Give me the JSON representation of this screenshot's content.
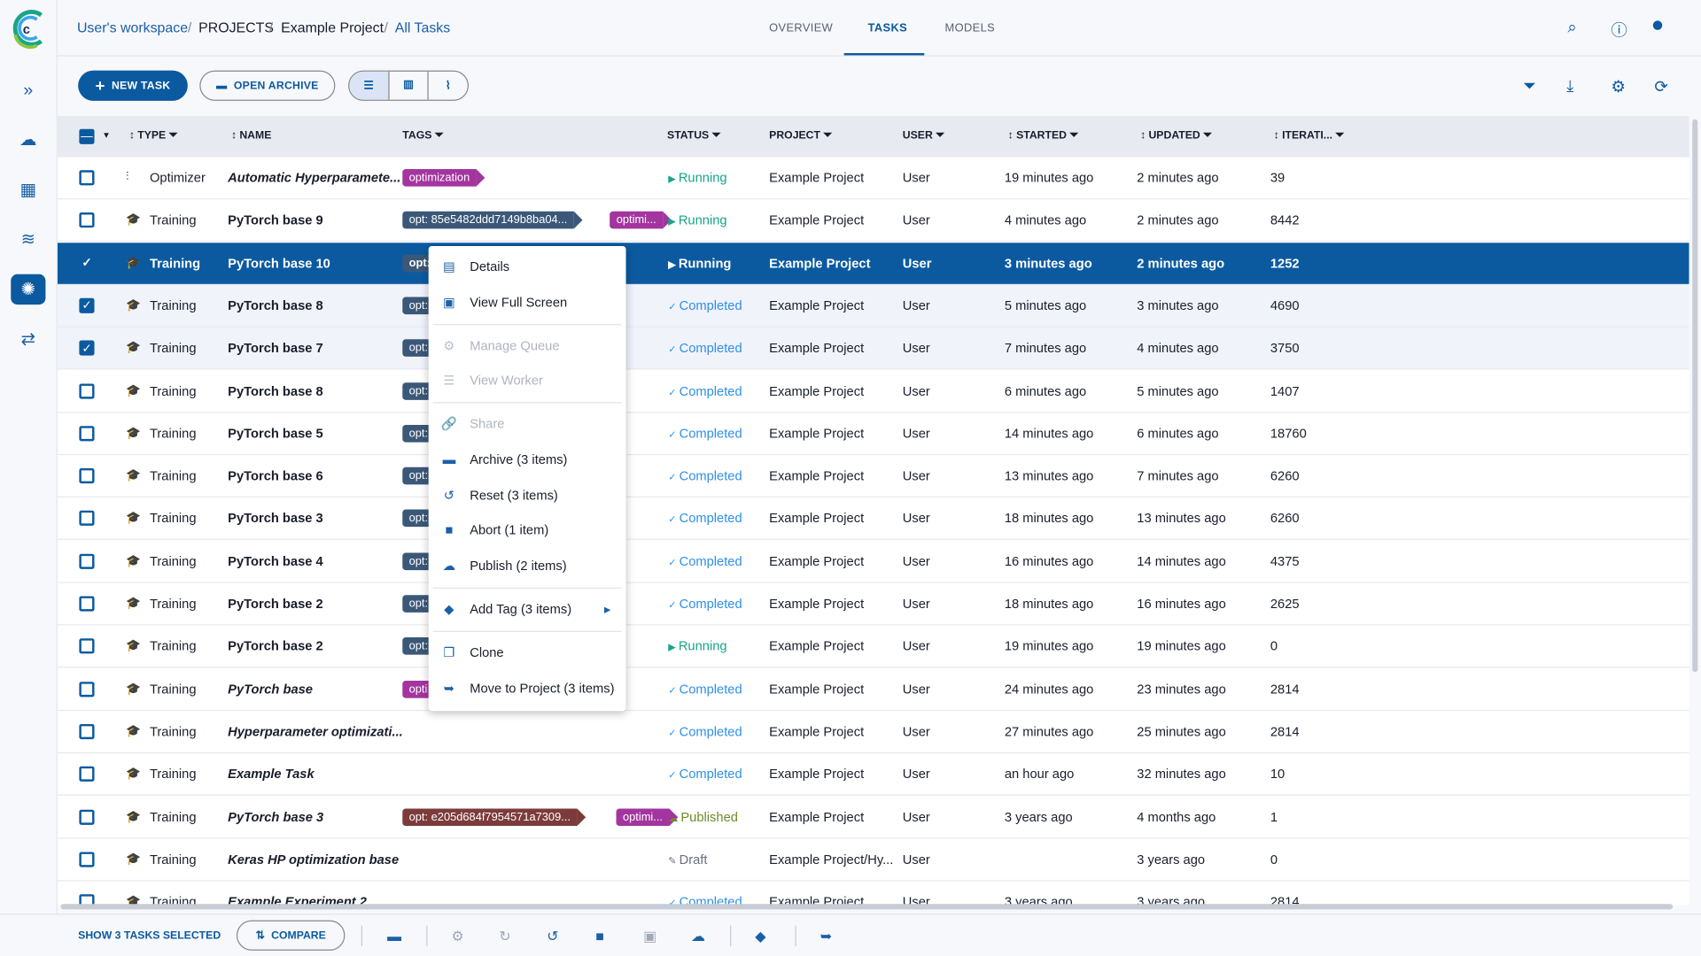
{
  "breadcrumb": [
    "User's workspace",
    "PROJECTS",
    "Example Project",
    "All Tasks"
  ],
  "nav_tabs": [
    "OVERVIEW",
    "TASKS",
    "MODELS"
  ],
  "toolbar": {
    "new_task": "NEW TASK",
    "open_archive": "OPEN ARCHIVE"
  },
  "columns": [
    "TYPE",
    "NAME",
    "TAGS",
    "STATUS",
    "PROJECT",
    "USER",
    "STARTED",
    "UPDATED",
    "ITERATI..."
  ],
  "colors": {
    "primary": "#0b5aa0",
    "tag_purple": "#a3359f",
    "tag_blue": "#3b5878",
    "tag_red": "#7c3b3b",
    "running": "#17a589",
    "completed": "#2f8fe8"
  },
  "rows": [
    {
      "type": "Optimizer",
      "name": "Automatic Hyperparamete...",
      "italic": true,
      "tags": [
        {
          "t": "optimization",
          "c": "#a3359f"
        }
      ],
      "status": "Running",
      "project": "Example Project",
      "user": "User",
      "started": "19 minutes ago",
      "updated": "2 minutes ago",
      "iter": "39",
      "state": ""
    },
    {
      "type": "Training",
      "name": "PyTorch base 9",
      "tags": [
        {
          "t": "opt: 85e5482ddd7149b8ba04...",
          "c": "#3b5878"
        },
        {
          "t": "optimi...",
          "c": "#a3359f"
        }
      ],
      "status": "Running",
      "project": "Example Project",
      "user": "User",
      "started": "4 minutes ago",
      "updated": "2 minutes ago",
      "iter": "8442",
      "state": ""
    },
    {
      "type": "Training",
      "name": "PyTorch base 10",
      "tags": [
        {
          "t": "opt:",
          "c": "#3b5878"
        },
        {
          "t": "",
          "c": "#a3359f"
        }
      ],
      "status": "Running",
      "project": "Example Project",
      "user": "User",
      "started": "3 minutes ago",
      "updated": "2 minutes ago",
      "iter": "1252",
      "state": "sel"
    },
    {
      "type": "Training",
      "name": "PyTorch base 8",
      "tags": [
        {
          "t": "opt:",
          "c": "#3b5878"
        },
        {
          "t": "",
          "c": "#a3359f"
        }
      ],
      "status": "Completed",
      "project": "Example Project",
      "user": "User",
      "started": "5 minutes ago",
      "updated": "3 minutes ago",
      "iter": "4690",
      "state": "chk"
    },
    {
      "type": "Training",
      "name": "PyTorch base 7",
      "tags": [
        {
          "t": "opt:",
          "c": "#3b5878"
        },
        {
          "t": "",
          "c": "#a3359f"
        }
      ],
      "status": "Completed",
      "project": "Example Project",
      "user": "User",
      "started": "7 minutes ago",
      "updated": "4 minutes ago",
      "iter": "3750",
      "state": "chk"
    },
    {
      "type": "Training",
      "name": "PyTorch base 8",
      "tags": [
        {
          "t": "opt:",
          "c": "#3b5878"
        },
        {
          "t": "",
          "c": "#a3359f"
        }
      ],
      "status": "Completed",
      "project": "Example Project",
      "user": "User",
      "started": "6 minutes ago",
      "updated": "5 minutes ago",
      "iter": "1407",
      "state": ""
    },
    {
      "type": "Training",
      "name": "PyTorch base 5",
      "tags": [
        {
          "t": "opt:",
          "c": "#3b5878"
        },
        {
          "t": "",
          "c": "#a3359f"
        }
      ],
      "status": "Completed",
      "project": "Example Project",
      "user": "User",
      "started": "14 minutes ago",
      "updated": "6 minutes ago",
      "iter": "18760",
      "state": ""
    },
    {
      "type": "Training",
      "name": "PyTorch base 6",
      "tags": [
        {
          "t": "opt:",
          "c": "#3b5878"
        },
        {
          "t": "",
          "c": "#a3359f"
        }
      ],
      "status": "Completed",
      "project": "Example Project",
      "user": "User",
      "started": "13 minutes ago",
      "updated": "7 minutes ago",
      "iter": "6260",
      "state": ""
    },
    {
      "type": "Training",
      "name": "PyTorch base 3",
      "tags": [
        {
          "t": "opt:",
          "c": "#3b5878"
        },
        {
          "t": "",
          "c": "#a3359f"
        }
      ],
      "status": "Completed",
      "project": "Example Project",
      "user": "User",
      "started": "18 minutes ago",
      "updated": "13 minutes ago",
      "iter": "6260",
      "state": ""
    },
    {
      "type": "Training",
      "name": "PyTorch base 4",
      "tags": [
        {
          "t": "opt:",
          "c": "#3b5878"
        },
        {
          "t": "",
          "c": "#a3359f"
        }
      ],
      "status": "Completed",
      "project": "Example Project",
      "user": "User",
      "started": "16 minutes ago",
      "updated": "14 minutes ago",
      "iter": "4375",
      "state": ""
    },
    {
      "type": "Training",
      "name": "PyTorch base 2",
      "tags": [
        {
          "t": "opt:",
          "c": "#3b5878"
        },
        {
          "t": "",
          "c": "#a3359f"
        }
      ],
      "status": "Completed",
      "project": "Example Project",
      "user": "User",
      "started": "18 minutes ago",
      "updated": "16 minutes ago",
      "iter": "2625",
      "state": ""
    },
    {
      "type": "Training",
      "name": "PyTorch base 2",
      "tags": [
        {
          "t": "opt:",
          "c": "#3b5878"
        },
        {
          "t": "",
          "c": "#a3359f"
        }
      ],
      "status": "Running",
      "project": "Example Project",
      "user": "User",
      "started": "19 minutes ago",
      "updated": "19 minutes ago",
      "iter": "0",
      "state": ""
    },
    {
      "type": "Training",
      "name": "PyTorch base",
      "italic": true,
      "tags": [
        {
          "t": "opti",
          "c": "#a3359f"
        }
      ],
      "status": "Completed",
      "project": "Example Project",
      "user": "User",
      "started": "24 minutes ago",
      "updated": "23 minutes ago",
      "iter": "2814",
      "state": ""
    },
    {
      "type": "Training",
      "name": "Hyperparameter optimizati...",
      "italic": true,
      "tags": [],
      "status": "Completed",
      "project": "Example Project",
      "user": "User",
      "started": "27 minutes ago",
      "updated": "25 minutes ago",
      "iter": "2814",
      "state": ""
    },
    {
      "type": "Training",
      "name": "Example Task",
      "italic": true,
      "tags": [],
      "status": "Completed",
      "project": "Example Project",
      "user": "User",
      "started": "an hour ago",
      "updated": "32 minutes ago",
      "iter": "10",
      "state": ""
    },
    {
      "type": "Training",
      "name": "PyTorch base 3",
      "italic": true,
      "tags": [
        {
          "t": "opt: e205d684f7954571a7309...",
          "c": "#7c3b3b"
        },
        {
          "t": "optimi...",
          "c": "#a3359f"
        }
      ],
      "status": "Published",
      "project": "Example Project",
      "user": "User",
      "started": "3 years ago",
      "updated": "4 months ago",
      "iter": "1",
      "state": ""
    },
    {
      "type": "Training",
      "name": "Keras HP optimization base",
      "italic": true,
      "tags": [],
      "status": "Draft",
      "project": "Example Project/Hy...",
      "user": "User",
      "started": "",
      "updated": "3 years ago",
      "iter": "0",
      "state": ""
    },
    {
      "type": "Training",
      "name": "Example Experiment 2",
      "italic": true,
      "tags": [],
      "status": "Completed",
      "project": "Example Project",
      "user": "User",
      "started": "3 years ago",
      "updated": "3 years ago",
      "iter": "2814",
      "state": ""
    }
  ],
  "context_menu": [
    {
      "label": "Details",
      "icon": "details-icon",
      "glyph": "▤",
      "disabled": false
    },
    {
      "label": "View Full Screen",
      "icon": "fullscreen-icon",
      "glyph": "▣",
      "disabled": false
    },
    {
      "label": "Manage Queue",
      "icon": "queue-icon",
      "glyph": "⚙",
      "disabled": true
    },
    {
      "label": "View Worker",
      "icon": "worker-icon",
      "glyph": "☰",
      "disabled": true
    },
    {
      "label": "Share",
      "icon": "link-icon",
      "glyph": "🔗",
      "disabled": true
    },
    {
      "label": "Archive (3 items)",
      "icon": "archive-icon",
      "glyph": "▬",
      "disabled": false
    },
    {
      "label": "Reset (3 items)",
      "icon": "reset-icon",
      "glyph": "↺",
      "disabled": false
    },
    {
      "label": "Abort (1 item)",
      "icon": "abort-icon",
      "glyph": "■",
      "disabled": false
    },
    {
      "label": "Publish (2 items)",
      "icon": "publish-icon",
      "glyph": "☁",
      "disabled": false
    },
    {
      "label": "Add Tag (3 items)",
      "icon": "tag-icon",
      "glyph": "◆",
      "disabled": false,
      "submenu": true
    },
    {
      "label": "Clone",
      "icon": "clone-icon",
      "glyph": "❐",
      "disabled": false
    },
    {
      "label": "Move to Project (3 items)",
      "icon": "move-icon",
      "glyph": "➥",
      "disabled": false
    }
  ],
  "bottom": {
    "selected_label": "SHOW 3 TASKS SELECTED",
    "compare": "COMPARE"
  }
}
